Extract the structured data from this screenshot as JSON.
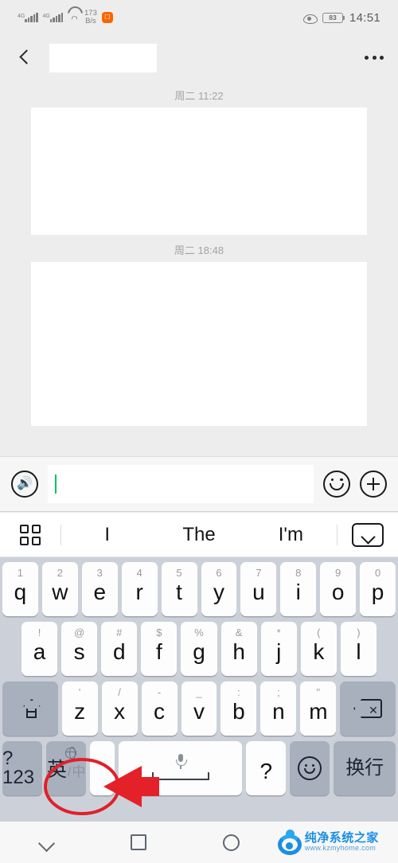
{
  "statusbar": {
    "network_type_1": "4G",
    "network_type_2": "4G",
    "net_speed_value": "173",
    "net_speed_unit": "B/s",
    "app_icon_name": "orange-app-icon",
    "eye_comfort_icon": "eye-icon",
    "battery_percent": "83",
    "clock": "14:51"
  },
  "titlebar": {
    "back_icon": "back-chevron-icon",
    "contact_name": "",
    "more_icon": "more-options-icon"
  },
  "chat": {
    "messages": [
      {
        "daystamp": "周二 11:22",
        "body": ""
      },
      {
        "daystamp": "周二 18:48",
        "body": ""
      }
    ]
  },
  "inputbar": {
    "voice_icon": "voice-input-icon",
    "input_value": "",
    "input_placeholder": "",
    "emoji_icon": "emoji-face-icon",
    "plus_icon": "plus-more-icon",
    "caret_color": "#07c160"
  },
  "suggestbar": {
    "grid_icon": "keyboard-grid-icon",
    "suggestions": [
      "I",
      "The",
      "I'm"
    ],
    "collapse_icon": "chevron-down-boxed-icon"
  },
  "keyboard": {
    "row1": [
      {
        "main": "q",
        "sub": "1"
      },
      {
        "main": "w",
        "sub": "2"
      },
      {
        "main": "e",
        "sub": "3"
      },
      {
        "main": "r",
        "sub": "4"
      },
      {
        "main": "t",
        "sub": "5"
      },
      {
        "main": "y",
        "sub": "6"
      },
      {
        "main": "u",
        "sub": "7"
      },
      {
        "main": "i",
        "sub": "8"
      },
      {
        "main": "o",
        "sub": "9"
      },
      {
        "main": "p",
        "sub": "0"
      }
    ],
    "row2": [
      {
        "main": "a",
        "sub": "!"
      },
      {
        "main": "s",
        "sub": "@"
      },
      {
        "main": "d",
        "sub": "#"
      },
      {
        "main": "f",
        "sub": "$"
      },
      {
        "main": "g",
        "sub": "%"
      },
      {
        "main": "h",
        "sub": "&"
      },
      {
        "main": "j",
        "sub": "*"
      },
      {
        "main": "k",
        "sub": "("
      },
      {
        "main": "l",
        "sub": ")"
      }
    ],
    "row3": [
      {
        "main": "z",
        "sub": "'"
      },
      {
        "main": "x",
        "sub": "/"
      },
      {
        "main": "c",
        "sub": "-"
      },
      {
        "main": "v",
        "sub": "_"
      },
      {
        "main": "b",
        "sub": ":"
      },
      {
        "main": "n",
        "sub": ";"
      },
      {
        "main": "m",
        "sub": "\""
      }
    ],
    "shift_icon": "shift-icon",
    "backspace_icon": "backspace-icon",
    "numeric_label": "?123",
    "lang_primary": "英",
    "lang_slash": "/",
    "lang_secondary": "中",
    "globe_icon": "globe-icon",
    "blank_key_label": "",
    "mic_icon": "microphone-icon",
    "space_label": "",
    "question_label": "?",
    "emoji_icon": "smiley-icon",
    "enter_label": "换行",
    "key_bg": "#fdfdfd",
    "mod_key_bg": "#a9b0bd",
    "keyboard_bg": "#ccd1d9"
  },
  "annotation": {
    "highlight_shape": "red-ellipse",
    "highlight_target": "lang-switch-key",
    "arrow": "red-left-arrow",
    "color": "#e0202a"
  },
  "navbar": {
    "hide_keyboard_icon": "chevron-down-icon",
    "recents_icon": "square-recents-icon",
    "home_icon": "circle-home-icon",
    "watermark_name": "纯净系统之家",
    "watermark_url": "www.kzmyhome.com"
  }
}
